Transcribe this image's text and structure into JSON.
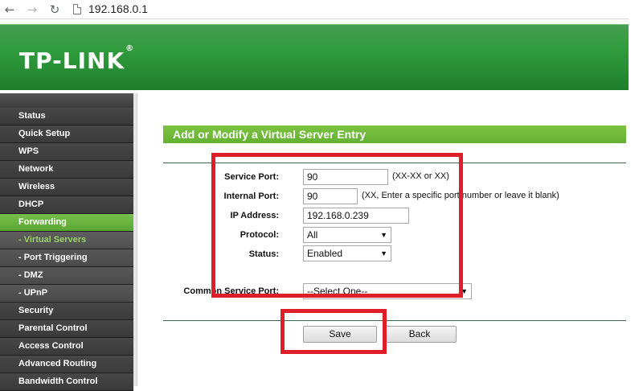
{
  "browser": {
    "url": "192.168.0.1",
    "back_icon": "arrow-left-icon",
    "forward_icon": "arrow-right-icon",
    "reload_icon": "reload-icon",
    "page_icon": "page-icon"
  },
  "header": {
    "logo": "TP-LINK",
    "logo_mark": "®"
  },
  "sidebar": {
    "items": [
      {
        "label": "Status"
      },
      {
        "label": "Quick Setup"
      },
      {
        "label": "WPS"
      },
      {
        "label": "Network"
      },
      {
        "label": "Wireless"
      },
      {
        "label": "DHCP"
      },
      {
        "label": "Forwarding"
      },
      {
        "label": "- Virtual Servers"
      },
      {
        "label": "- Port Triggering"
      },
      {
        "label": "- DMZ"
      },
      {
        "label": "- UPnP"
      },
      {
        "label": "Security"
      },
      {
        "label": "Parental Control"
      },
      {
        "label": "Access Control"
      },
      {
        "label": "Advanced Routing"
      },
      {
        "label": "Bandwidth Control"
      }
    ]
  },
  "form": {
    "title": "Add or Modify a Virtual Server Entry",
    "service_port": {
      "label": "Service Port:",
      "value": "90",
      "hint": "(XX-XX or XX)"
    },
    "internal_port": {
      "label": "Internal Port:",
      "value": "90",
      "hint": "(XX, Enter a specific port number or leave it blank)"
    },
    "ip_address": {
      "label": "IP Address:",
      "value": "192.168.0.239"
    },
    "protocol": {
      "label": "Protocol:",
      "value": "All"
    },
    "status": {
      "label": "Status:",
      "value": "Enabled"
    },
    "common_service_port": {
      "label": "Common Service Port:",
      "value": "--Select One--"
    },
    "save_label": "Save",
    "back_label": "Back"
  },
  "colors": {
    "header_green": "#2e9b3b",
    "accent_green": "#6ab43a",
    "highlight_red": "#e01e2a",
    "sidebar_dark": "#3a3a3a"
  }
}
